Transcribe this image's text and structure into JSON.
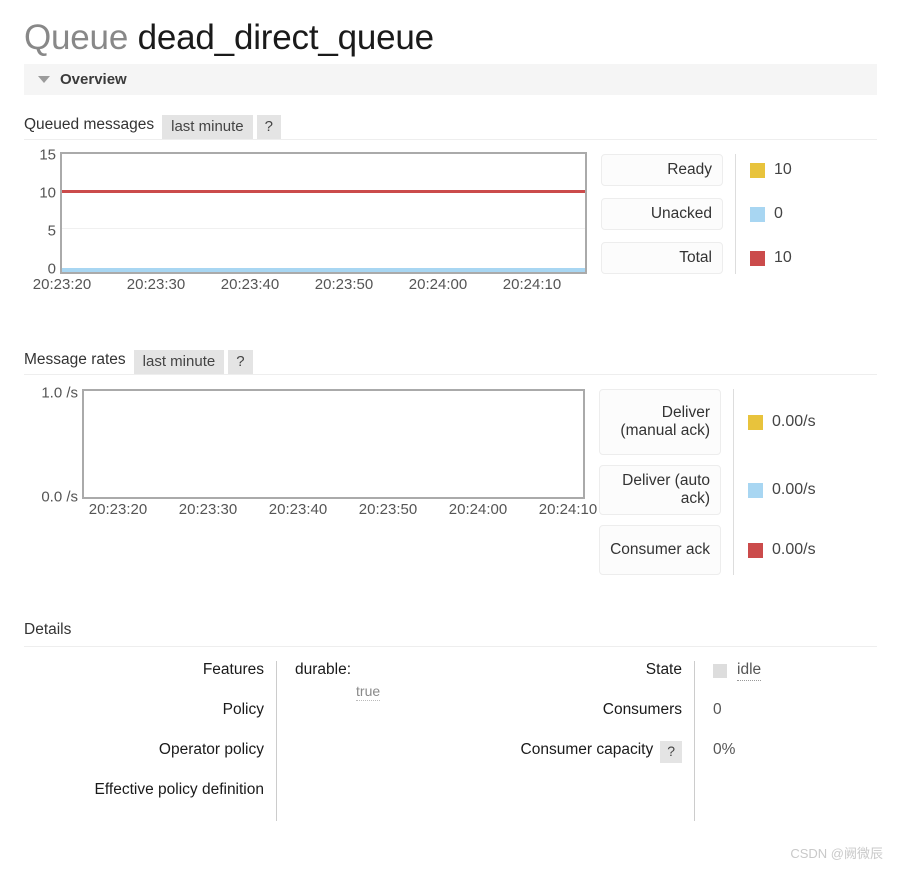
{
  "header": {
    "title_kind": "Queue",
    "title_name": "dead_direct_queue",
    "section_label": "Overview",
    "collapse_icon": "triangle-down-icon"
  },
  "queued_messages": {
    "title": "Queued messages",
    "period_tab": "last minute",
    "help_tab": "?",
    "legend": [
      {
        "label": "Ready",
        "value": "10",
        "color": "#e8c33c"
      },
      {
        "label": "Unacked",
        "value": "0",
        "color": "#a8d6f2"
      },
      {
        "label": "Total",
        "value": "10",
        "color": "#cb4b4b"
      }
    ]
  },
  "message_rates": {
    "title": "Message rates",
    "period_tab": "last minute",
    "help_tab": "?",
    "legend": [
      {
        "label": "Deliver (manual ack)",
        "value": "0.00/s",
        "color": "#e8c33c"
      },
      {
        "label": "Deliver (auto ack)",
        "value": "0.00/s",
        "color": "#a8d6f2"
      },
      {
        "label": "Consumer ack",
        "value": "0.00/s",
        "color": "#cb4b4b"
      }
    ]
  },
  "details": {
    "heading": "Details",
    "left_rows": [
      {
        "label": "Features",
        "key": "durable:",
        "value": "true"
      },
      {
        "label": "Policy",
        "key": "",
        "value": ""
      },
      {
        "label": "Operator policy",
        "key": "",
        "value": ""
      },
      {
        "label": "Effective policy definition",
        "key": "",
        "value": ""
      }
    ],
    "right_rows": [
      {
        "label": "State",
        "help": "",
        "value": "idle",
        "kind": "state"
      },
      {
        "label": "Consumers",
        "help": "",
        "value": "0",
        "kind": "plain"
      },
      {
        "label": "Consumer capacity",
        "help": "?",
        "value": "0%",
        "kind": "plain"
      }
    ]
  },
  "watermark": "CSDN @阙微辰",
  "chart_data": [
    {
      "type": "line",
      "title": "Queued messages",
      "xlabel": "",
      "ylabel": "",
      "x": [
        "20:23:20",
        "20:23:30",
        "20:23:40",
        "20:23:50",
        "20:24:00",
        "20:24:10"
      ],
      "yticks": [
        0,
        5,
        10,
        15
      ],
      "ylim": [
        0,
        15
      ],
      "grid": true,
      "legend_position": "right",
      "series": [
        {
          "name": "Ready",
          "color": "#e8c33c",
          "values": [
            10,
            10,
            10,
            10,
            10,
            10
          ],
          "current": 10
        },
        {
          "name": "Unacked",
          "color": "#a8d6f2",
          "values": [
            0,
            0,
            0,
            0,
            0,
            0
          ],
          "current": 0
        },
        {
          "name": "Total",
          "color": "#cb4b4b",
          "values": [
            10,
            10,
            10,
            10,
            10,
            10
          ],
          "current": 10
        }
      ]
    },
    {
      "type": "line",
      "title": "Message rates",
      "xlabel": "",
      "ylabel": "",
      "x": [
        "20:23:20",
        "20:23:30",
        "20:23:40",
        "20:23:50",
        "20:24:00",
        "20:24:10"
      ],
      "yticks": [
        "0.0 /s",
        "1.0 /s"
      ],
      "ylim": [
        0,
        1
      ],
      "grid": false,
      "legend_position": "right",
      "series": [
        {
          "name": "Deliver (manual ack)",
          "color": "#e8c33c",
          "values": [],
          "current": "0.00/s"
        },
        {
          "name": "Deliver (auto ack)",
          "color": "#a8d6f2",
          "values": [],
          "current": "0.00/s"
        },
        {
          "name": "Consumer ack",
          "color": "#cb4b4b",
          "values": [],
          "current": "0.00/s"
        }
      ]
    }
  ]
}
